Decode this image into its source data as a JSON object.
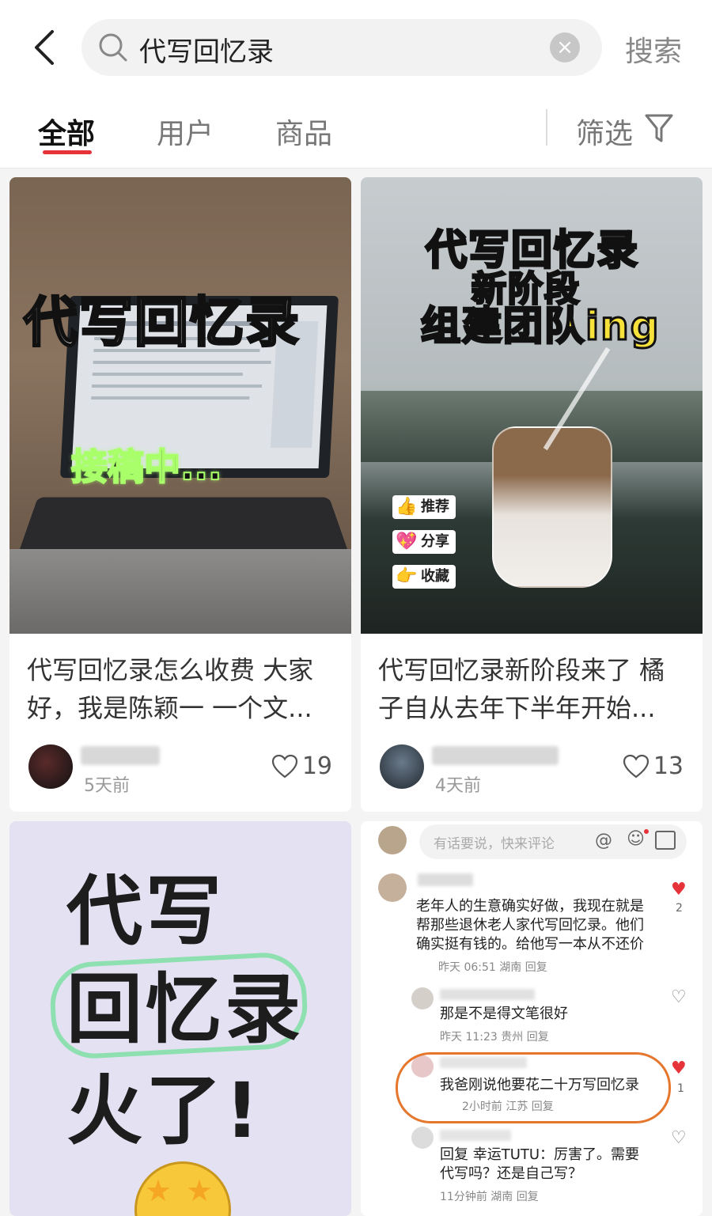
{
  "search": {
    "query": "代写回忆录",
    "button": "搜索"
  },
  "tabs": {
    "all": "全部",
    "users": "用户",
    "goods": "商品",
    "filter": "筛选"
  },
  "cards": [
    {
      "image_caption": "代写回忆录",
      "image_sub": "接稿中...",
      "title_line1": "代写回忆录怎么收费 大家",
      "title_line2": "好，我是陈颖一 一个文...",
      "time": "5天前",
      "likes": "19"
    },
    {
      "image_caption": "代写回忆录",
      "image_caption2": "新阶段",
      "image_caption3": "组建团队ing",
      "badge1": "推荐",
      "badge2": "分享",
      "badge3": "收藏",
      "title_line1": "代写回忆录新阶段来了 橘",
      "title_line2": "子自从去年下半年开始...",
      "time": "4天前",
      "likes": "13"
    },
    {
      "line1": "代写",
      "line2": "回忆录",
      "line3": "火了!"
    },
    {
      "input_placeholder": "有话要说，快来评论",
      "comments": [
        {
          "text1": "老年人的生意确实好做，我现在就是",
          "text2": "帮那些退休老人家代写回忆录。他们",
          "text3": "确实挺有钱的。给他写一本从不还价",
          "meta": "昨天 06:51 湖南 回复",
          "likes": "2"
        },
        {
          "text1": "那是不是得文笔很好",
          "meta": "昨天 11:23 贵州 回复"
        },
        {
          "text1": "我爸刚说他要花二十万写回忆录",
          "meta": "2小时前 江苏 回复",
          "likes": "1"
        },
        {
          "text1": "回复 幸运TUTU：厉害了。需要",
          "text2": "代写吗？还是自己写？",
          "meta": "11分钟前 湖南 回复"
        }
      ]
    }
  ],
  "colors": {
    "accent": "#e53339",
    "bg": "#f4f4f4"
  }
}
